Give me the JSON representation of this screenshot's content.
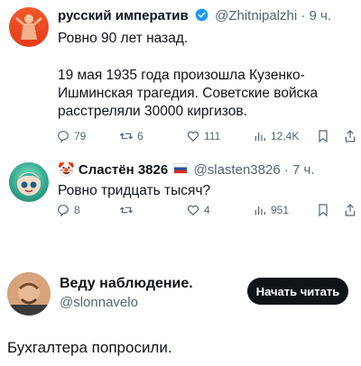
{
  "tweet1": {
    "name": "русский императив",
    "handle": "@Zhitnipalzhi",
    "time": "· 9 ч.",
    "line1": "Ровно 90 лет назад.",
    "line2": "19 мая 1935 года произошла Кузенко-",
    "line3": "Ишминская трагедия. Советские войска",
    "line4": "расстреляли 30000 киргизов.",
    "replies": "79",
    "retweets": "6",
    "likes": "111",
    "views": "12,4K"
  },
  "tweet2": {
    "name": "Сластён 3826",
    "handle": "@slasten3826",
    "time": "· 7 ч.",
    "text": "Ровно тридцать тысяч?",
    "replies": "8",
    "retweets": "",
    "likes": "4",
    "views": "951"
  },
  "follow_card": {
    "name": "Веду наблюдение.",
    "handle": "@slonnavelo",
    "button": "Начать читать"
  },
  "caption": "Бухгалтера попросили.",
  "colors": {
    "verified": "#1d9bf0",
    "accent": "#0f1419",
    "muted": "#536471"
  },
  "icons": [
    "reply-icon",
    "retweet-icon",
    "like-icon",
    "views-icon",
    "bookmark-icon",
    "share-icon",
    "verified-badge-icon",
    "clown-emoji",
    "russia-flag"
  ]
}
